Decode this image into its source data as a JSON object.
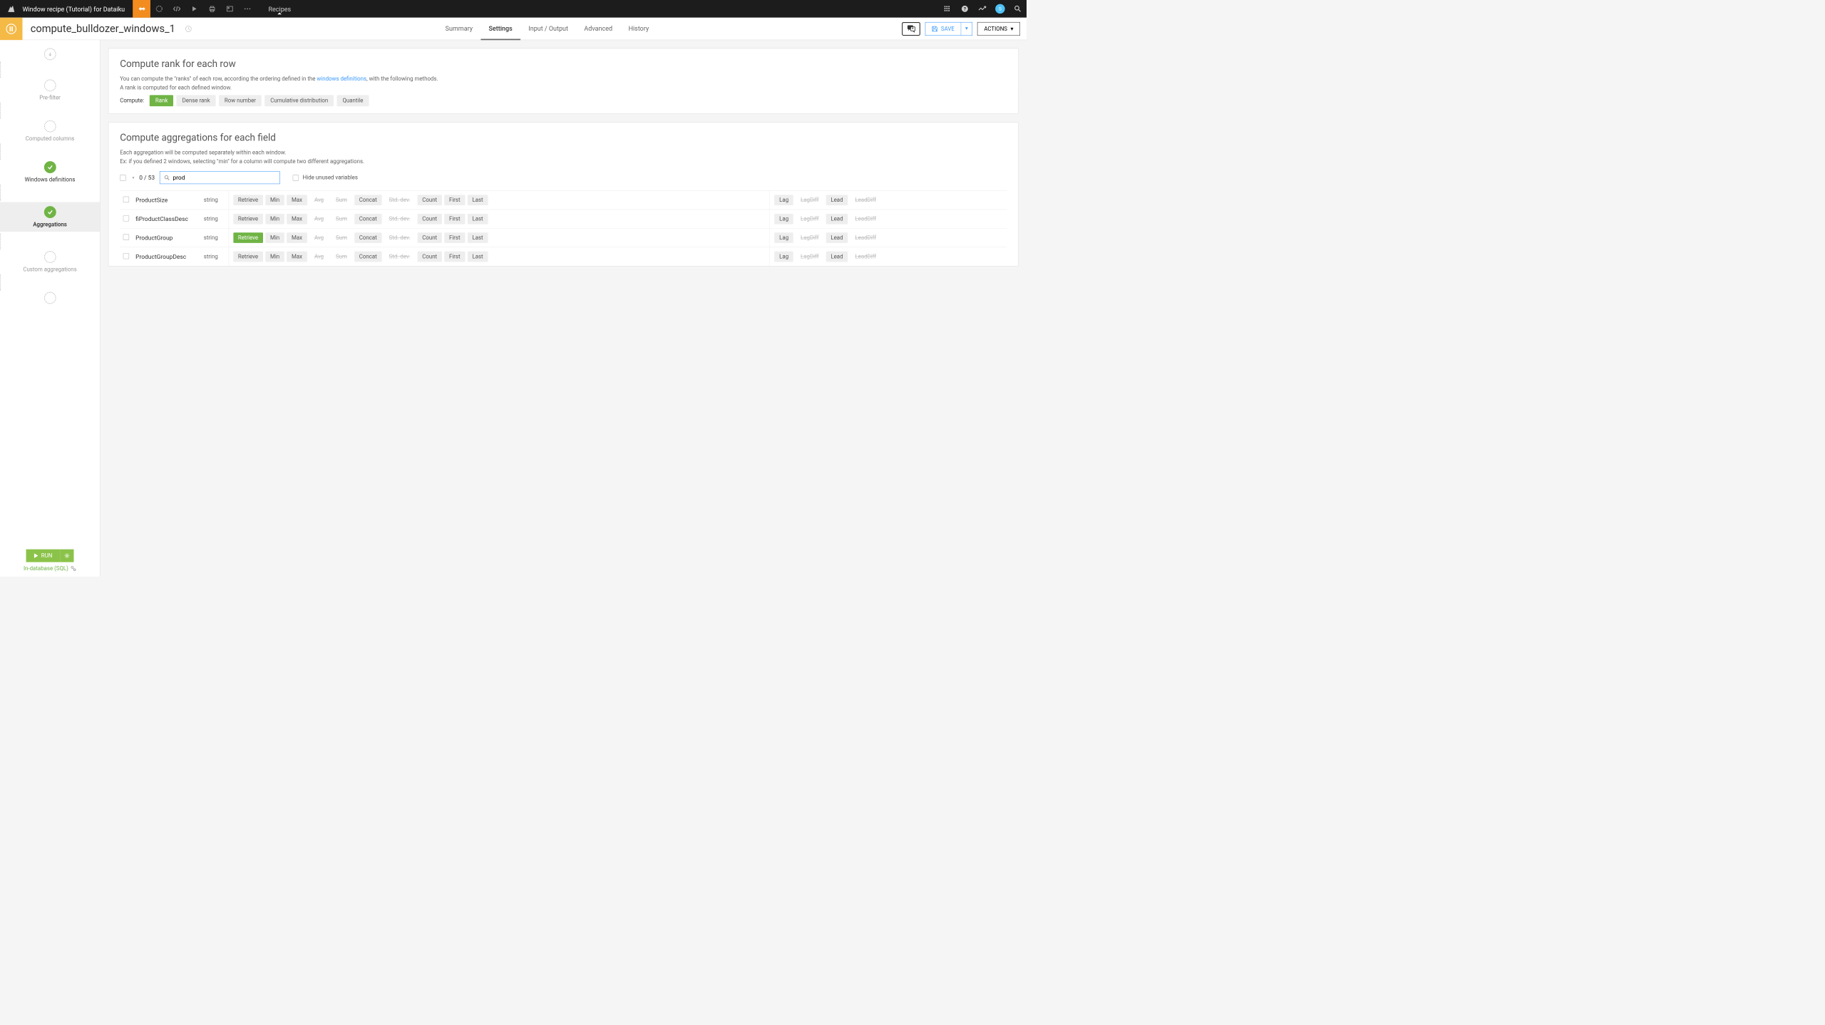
{
  "topbar": {
    "title": "Window recipe (Tutorial) for Dataiku",
    "center_label": "Recipes",
    "avatar_letter": "S"
  },
  "subbar": {
    "recipe_name": "compute_bulldozer_windows_1",
    "tabs": [
      "Summary",
      "Settings",
      "Input / Output",
      "Advanced",
      "History"
    ],
    "active_tab": 1,
    "save_label": "SAVE",
    "actions_label": "ACTIONS"
  },
  "sidebar": {
    "steps": [
      {
        "label": "",
        "state": "start"
      },
      {
        "label": "Pre-filter",
        "state": "pending"
      },
      {
        "label": "Computed columns",
        "state": "pending"
      },
      {
        "label": "Windows definitions",
        "state": "done"
      },
      {
        "label": "Aggregations",
        "state": "active-done"
      },
      {
        "label": "Custom aggregations",
        "state": "pending"
      },
      {
        "label": "",
        "state": "end"
      }
    ],
    "run_label": "RUN",
    "engine_label": "In-database (SQL)"
  },
  "rank_section": {
    "title": "Compute rank for each row",
    "desc1_a": "You can compute the \"ranks\" of each row, according the ordering defined in the ",
    "desc1_link": "windows definitions",
    "desc1_b": ", with the following methods.",
    "desc2": "A rank is computed for each defined window.",
    "compute_label": "Compute:",
    "options": [
      "Rank",
      "Dense rank",
      "Row number",
      "Cumulative distribution",
      "Quantile"
    ],
    "active_option": 0
  },
  "agg_section": {
    "title": "Compute aggregations for each field",
    "desc1": "Each aggregation will be computed separately within each window.",
    "desc2": "Ex: if you defined 2 windows, selecting \"min\" for a column will compute two different aggregations.",
    "count": "0 / 53",
    "search_value": "prod",
    "hide_label": "Hide unused variables",
    "columns": [
      {
        "name": "ProductSize",
        "type": "string",
        "retrieve_active": false
      },
      {
        "name": "fiProductClassDesc",
        "type": "string",
        "retrieve_active": false
      },
      {
        "name": "ProductGroup",
        "type": "string",
        "retrieve_active": true
      },
      {
        "name": "ProductGroupDesc",
        "type": "string",
        "retrieve_active": false
      }
    ],
    "agg_ops": [
      "Retrieve",
      "Min",
      "Max",
      "Avg",
      "Sum",
      "Concat",
      "Std. dev.",
      "Count",
      "First",
      "Last"
    ],
    "disabled_ops": [
      "Avg",
      "Sum",
      "Std. dev."
    ],
    "lag_ops": [
      "Lag",
      "LagDiff",
      "Lead",
      "LeadDiff"
    ],
    "lag_disabled": [
      "LagDiff",
      "LeadDiff"
    ]
  }
}
